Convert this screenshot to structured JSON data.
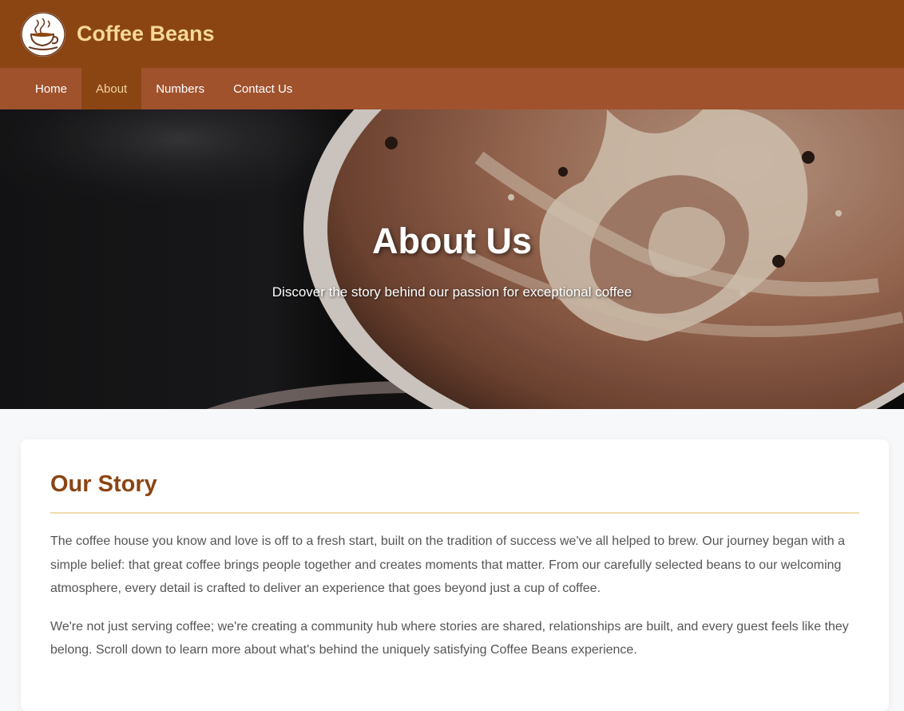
{
  "header": {
    "brand": "Coffee Beans",
    "logo_icon": "coffee-cup-icon",
    "background": "#8b4513",
    "brand_color": "#f7d89a"
  },
  "nav": {
    "background": "#a0522d",
    "items": [
      {
        "label": "Home",
        "active": false
      },
      {
        "label": "About",
        "active": true
      },
      {
        "label": "Numbers",
        "active": false
      },
      {
        "label": "Contact Us",
        "active": false
      }
    ]
  },
  "hero": {
    "title": "About Us",
    "subtitle": "Discover the story behind our passion for exceptional coffee"
  },
  "story": {
    "title": "Our Story",
    "title_color": "#8b4513",
    "paragraphs": [
      "The coffee house you know and love is off to a fresh start, built on the tradition of success we've all helped to brew. Our journey began with a simple belief: that great coffee brings people together and creates moments that matter. From our carefully selected beans to our welcoming atmosphere, every detail is crafted to deliver an experience that goes beyond just a cup of coffee.",
      "We're not just serving coffee; we're creating a community hub where stories are shared, relationships are built, and every guest feels like they belong. Scroll down to learn more about what's behind the uniquely satisfying Coffee Beans experience."
    ]
  }
}
